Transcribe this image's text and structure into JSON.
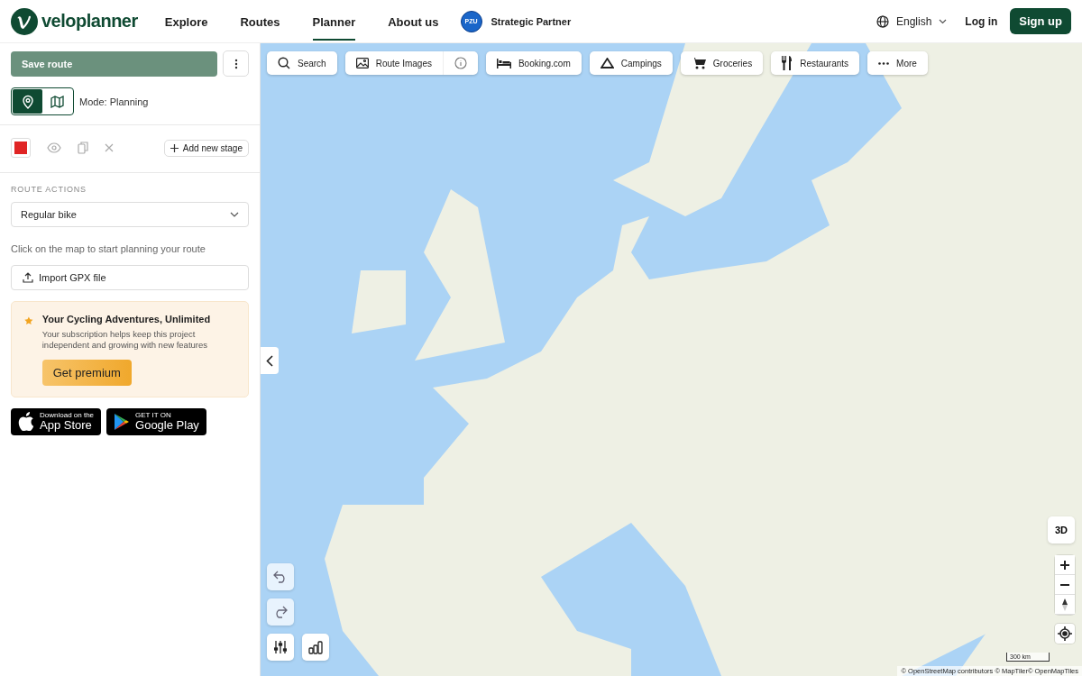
{
  "header": {
    "logo": "veloplanner",
    "nav": [
      {
        "label": "Explore",
        "selected": false
      },
      {
        "label": "Routes",
        "selected": false
      },
      {
        "label": "Planner",
        "selected": true
      },
      {
        "label": "About us",
        "selected": false
      }
    ],
    "partner": {
      "badge": "PZU",
      "label": "Strategic Partner"
    },
    "language": "English",
    "login": "Log in",
    "signup": "Sign up"
  },
  "sidebar": {
    "save_button": "Save route",
    "modes": [
      {
        "kind": "pin",
        "selected": true
      },
      {
        "kind": "map",
        "selected": false
      }
    ],
    "mode_label": "Mode: Planning",
    "stage": {
      "color": "#e02424"
    },
    "add_stage": "Add new stage",
    "section_title": "ROUTE ACTIONS",
    "bike_select": "Regular bike",
    "hint": "Click on the map to start planning your route",
    "import_button": "Import GPX file",
    "promo": {
      "title": "Your Cycling Adventures, Unlimited",
      "text": "Your subscription helps keep this project independent and growing with new features",
      "button": "Get premium"
    },
    "stores": [
      {
        "kind": "apple",
        "small": "Download on the",
        "big": "App Store"
      },
      {
        "kind": "google",
        "small": "GET IT ON",
        "big": "Google Play"
      }
    ]
  },
  "map": {
    "toolbar": [
      {
        "kind": "search",
        "label": "Search"
      },
      {
        "kind": "image",
        "label": "Route Images",
        "info": true
      },
      {
        "kind": "bed",
        "label": "Booking.com"
      },
      {
        "kind": "tent",
        "label": "Campings"
      },
      {
        "kind": "cart",
        "label": "Groceries"
      },
      {
        "kind": "fork",
        "label": "Restaurants"
      },
      {
        "kind": "dots",
        "label": "More"
      }
    ],
    "three_d": "3D",
    "scale": "300 km",
    "attribution": "© OpenStreetMap contributors © MapTiler© OpenMapTiles"
  }
}
